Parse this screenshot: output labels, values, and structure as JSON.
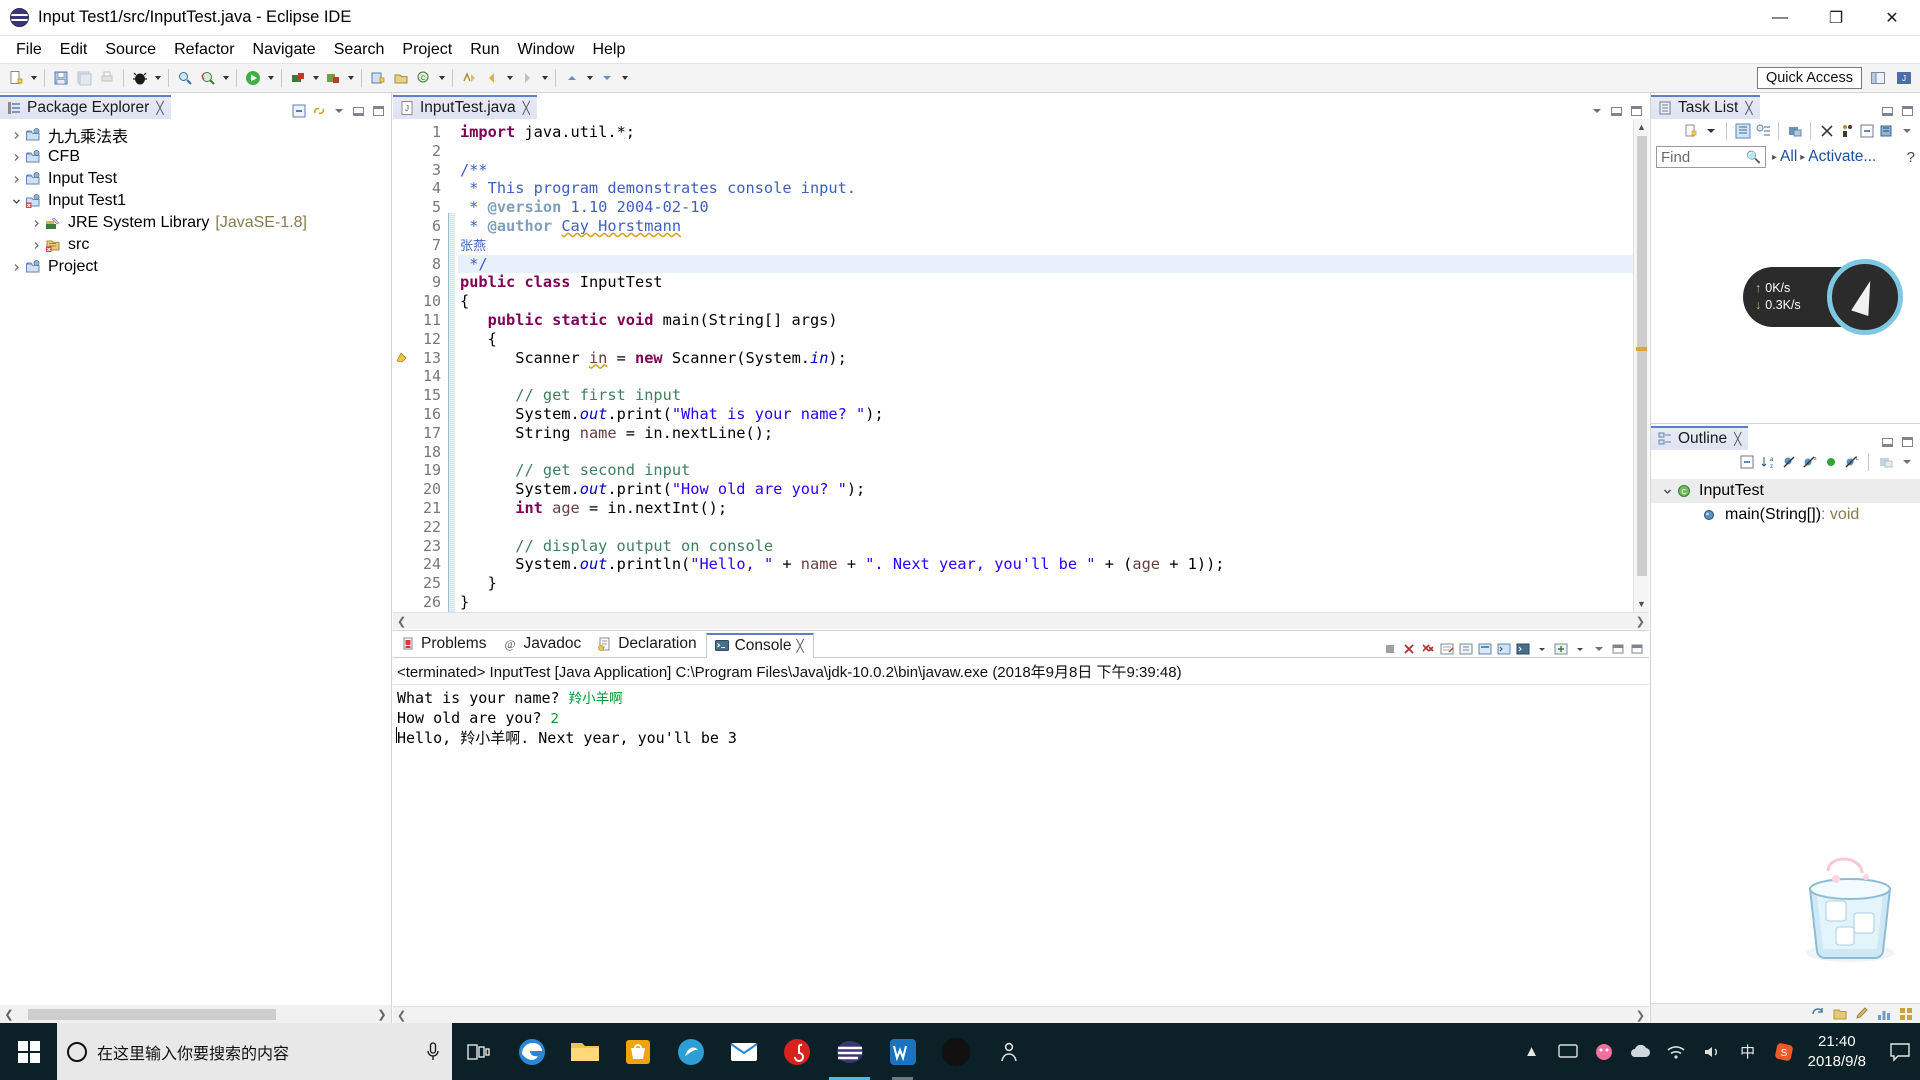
{
  "window": {
    "title": "Input Test1/src/InputTest.java - Eclipse IDE",
    "minimize": "—",
    "maximize": "❐",
    "close": "✕"
  },
  "menubar": {
    "items": [
      "File",
      "Edit",
      "Source",
      "Refactor",
      "Navigate",
      "Search",
      "Project",
      "Run",
      "Window",
      "Help"
    ]
  },
  "toolbar": {
    "quick_access_label": "Quick Access"
  },
  "package_explorer": {
    "title": "Package Explorer",
    "close": "╳",
    "items": [
      {
        "label": "九九乘法表",
        "expanded": false,
        "indent": 0,
        "icon": "java-project-icon"
      },
      {
        "label": "CFB",
        "expanded": false,
        "indent": 0,
        "icon": "java-project-icon"
      },
      {
        "label": "Input Test",
        "expanded": false,
        "indent": 0,
        "icon": "java-project-icon"
      },
      {
        "label": "Input Test1",
        "expanded": true,
        "indent": 0,
        "icon": "java-project-error-icon"
      },
      {
        "label": "JRE System Library",
        "sub": "[JavaSE-1.8]",
        "expanded": false,
        "indent": 1,
        "icon": "library-icon"
      },
      {
        "label": "src",
        "expanded": false,
        "indent": 1,
        "icon": "source-folder-error-icon"
      },
      {
        "label": "Project",
        "expanded": false,
        "indent": 0,
        "icon": "java-project-icon"
      }
    ]
  },
  "editor": {
    "tab_label": "InputTest.java",
    "tab_close": "╳",
    "first_line": 1,
    "lines": [
      {
        "n": 1,
        "fold": "",
        "tokens": [
          {
            "t": "import ",
            "c": "kw"
          },
          {
            "t": "java.util.*;",
            "c": ""
          }
        ]
      },
      {
        "n": 2,
        "fold": "",
        "tokens": []
      },
      {
        "n": 3,
        "fold": "-",
        "tokens": [
          {
            "t": "/**",
            "c": "jdoc"
          }
        ]
      },
      {
        "n": 4,
        "fold": "",
        "tokens": [
          {
            "t": " * This program demonstrates console input.",
            "c": "jdoc"
          }
        ]
      },
      {
        "n": 5,
        "fold": "",
        "tokens": [
          {
            "t": " * ",
            "c": "jdoc"
          },
          {
            "t": "@version",
            "c": "jdoc-tag"
          },
          {
            "t": " 1.10 2004-02-10",
            "c": "jdoc"
          }
        ]
      },
      {
        "n": 6,
        "fold": "",
        "tokens": [
          {
            "t": " * ",
            "c": "jdoc"
          },
          {
            "t": "@author",
            "c": "jdoc-tag"
          },
          {
            "t": " ",
            "c": "jdoc"
          },
          {
            "t": "Cay Horstmann",
            "c": "jdoc sq"
          }
        ]
      },
      {
        "n": 7,
        "fold": "",
        "tokens": [
          {
            "t": "张燕",
            "c": "cn"
          }
        ]
      },
      {
        "n": 8,
        "fold": "",
        "hl": true,
        "tokens": [
          {
            "t": " */",
            "c": "jdoc"
          }
        ]
      },
      {
        "n": 9,
        "fold": "",
        "tokens": [
          {
            "t": "public class ",
            "c": "kw"
          },
          {
            "t": "InputTest",
            "c": ""
          }
        ]
      },
      {
        "n": 10,
        "fold": "",
        "tokens": [
          {
            "t": "{",
            "c": ""
          }
        ]
      },
      {
        "n": 11,
        "fold": "-",
        "tokens": [
          {
            "t": "   ",
            "c": ""
          },
          {
            "t": "public static void ",
            "c": "kw"
          },
          {
            "t": "main(String[] args)",
            "c": ""
          }
        ]
      },
      {
        "n": 12,
        "fold": "",
        "tokens": [
          {
            "t": "   {",
            "c": ""
          }
        ]
      },
      {
        "n": 13,
        "fold": "",
        "marker": "warning",
        "tokens": [
          {
            "t": "      Scanner ",
            "c": ""
          },
          {
            "t": "in",
            "c": "loc sq"
          },
          {
            "t": " = ",
            "c": ""
          },
          {
            "t": "new ",
            "c": "kw"
          },
          {
            "t": "Scanner(System.",
            "c": ""
          },
          {
            "t": "in",
            "c": "fld"
          },
          {
            "t": ");",
            "c": ""
          }
        ]
      },
      {
        "n": 14,
        "fold": "",
        "tokens": []
      },
      {
        "n": 15,
        "fold": "",
        "tokens": [
          {
            "t": "      // get first input",
            "c": "cmt"
          }
        ]
      },
      {
        "n": 16,
        "fold": "",
        "tokens": [
          {
            "t": "      System.",
            "c": ""
          },
          {
            "t": "out",
            "c": "fld"
          },
          {
            "t": ".print(",
            "c": ""
          },
          {
            "t": "\"What is your name? \"",
            "c": "str"
          },
          {
            "t": ");",
            "c": ""
          }
        ]
      },
      {
        "n": 17,
        "fold": "",
        "tokens": [
          {
            "t": "      String ",
            "c": ""
          },
          {
            "t": "name",
            "c": "loc"
          },
          {
            "t": " = in.nextLine();",
            "c": ""
          }
        ]
      },
      {
        "n": 18,
        "fold": "",
        "tokens": []
      },
      {
        "n": 19,
        "fold": "",
        "tokens": [
          {
            "t": "      // get second input",
            "c": "cmt"
          }
        ]
      },
      {
        "n": 20,
        "fold": "",
        "tokens": [
          {
            "t": "      System.",
            "c": ""
          },
          {
            "t": "out",
            "c": "fld"
          },
          {
            "t": ".print(",
            "c": ""
          },
          {
            "t": "\"How old are you? \"",
            "c": "str"
          },
          {
            "t": ");",
            "c": ""
          }
        ]
      },
      {
        "n": 21,
        "fold": "",
        "tokens": [
          {
            "t": "      ",
            "c": ""
          },
          {
            "t": "int ",
            "c": "kw"
          },
          {
            "t": "age",
            "c": "loc"
          },
          {
            "t": " = in.nextInt();",
            "c": ""
          }
        ]
      },
      {
        "n": 22,
        "fold": "",
        "tokens": []
      },
      {
        "n": 23,
        "fold": "",
        "tokens": [
          {
            "t": "      // display output on console",
            "c": "cmt"
          }
        ]
      },
      {
        "n": 24,
        "fold": "",
        "tokens": [
          {
            "t": "      System.",
            "c": ""
          },
          {
            "t": "out",
            "c": "fld"
          },
          {
            "t": ".println(",
            "c": ""
          },
          {
            "t": "\"Hello, \"",
            "c": "str"
          },
          {
            "t": " + ",
            "c": ""
          },
          {
            "t": "name",
            "c": "loc"
          },
          {
            "t": " + ",
            "c": ""
          },
          {
            "t": "\". Next year, you'll be \"",
            "c": "str"
          },
          {
            "t": " + (",
            "c": ""
          },
          {
            "t": "age",
            "c": "loc"
          },
          {
            "t": " + 1));",
            "c": ""
          }
        ]
      },
      {
        "n": 25,
        "fold": "",
        "tokens": [
          {
            "t": "   }",
            "c": ""
          }
        ]
      },
      {
        "n": 26,
        "fold": "",
        "tokens": [
          {
            "t": "}",
            "c": ""
          }
        ]
      }
    ]
  },
  "console": {
    "tabs": [
      {
        "label": "Problems",
        "icon": "problems-icon",
        "active": false
      },
      {
        "label": "Javadoc",
        "icon": "javadoc-icon",
        "active": false
      },
      {
        "label": "Declaration",
        "icon": "declaration-icon",
        "active": false
      },
      {
        "label": "Console",
        "icon": "console-icon",
        "active": true
      }
    ],
    "tab_close": "╳",
    "header": "<terminated> InputTest [Java Application] C:\\Program Files\\Java\\jdk-10.0.2\\bin\\javaw.exe (2018年9月8日 下午9:39:48)",
    "output": [
      {
        "prompt": "What is your name? ",
        "input": "羚小羊啊"
      },
      {
        "prompt": "How old are you? ",
        "input": "2"
      },
      {
        "prompt": "Hello, 羚小羊啊. Next year, you'll be 3",
        "input": ""
      }
    ]
  },
  "task_list": {
    "title": "Task List",
    "close": "╳",
    "find_placeholder": "Find",
    "breadcrumbs": [
      "All",
      "Activate..."
    ],
    "help": "?",
    "net_widget": {
      "up_label": "0K/s",
      "down_label": "0.3K/s",
      "up_arrow": "↑",
      "down_arrow": "↓"
    }
  },
  "outline": {
    "title": "Outline",
    "close": "╳",
    "items": [
      {
        "label": "InputTest",
        "indent": 0,
        "expanded": true,
        "icon": "class-icon",
        "selected": true
      },
      {
        "label": "main(String[])",
        "suffix": " : void",
        "indent": 1,
        "icon": "method-static-icon",
        "selected": false
      }
    ]
  },
  "taskbar": {
    "search_placeholder": "在这里输入你要搜索的内容",
    "time": "21:40",
    "date": "2018/9/8",
    "ime_label": "中"
  }
}
